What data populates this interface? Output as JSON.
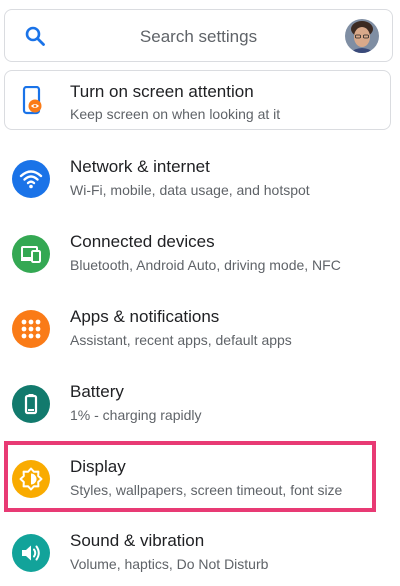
{
  "search": {
    "placeholder": "Search settings"
  },
  "suggestion": {
    "title": "Turn on screen attention",
    "summary": "Keep screen on when looking at it",
    "icon": "phone-eye-icon"
  },
  "settings": [
    {
      "title": "Network & internet",
      "summary": "Wi-Fi, mobile, data usage, and hotspot",
      "icon": "wifi-icon",
      "color": "#1a73e8"
    },
    {
      "title": "Connected devices",
      "summary": "Bluetooth, Android Auto, driving mode, NFC",
      "icon": "connected-devices-icon",
      "color": "#34a853"
    },
    {
      "title": "Apps & notifications",
      "summary": "Assistant, recent apps, default apps",
      "icon": "apps-icon",
      "color": "#fa7b17"
    },
    {
      "title": "Battery",
      "summary": "1% - charging rapidly",
      "icon": "battery-icon",
      "color": "#127a6d"
    },
    {
      "title": "Display",
      "summary": "Styles, wallpapers, screen timeout, font size",
      "icon": "brightness-icon",
      "color": "#f9ab00"
    },
    {
      "title": "Sound & vibration",
      "summary": "Volume, haptics, Do Not Disturb",
      "icon": "volume-icon",
      "color": "#12a39a"
    }
  ],
  "colors": {
    "highlight": "#e83a74",
    "accent": "#1a73e8"
  }
}
